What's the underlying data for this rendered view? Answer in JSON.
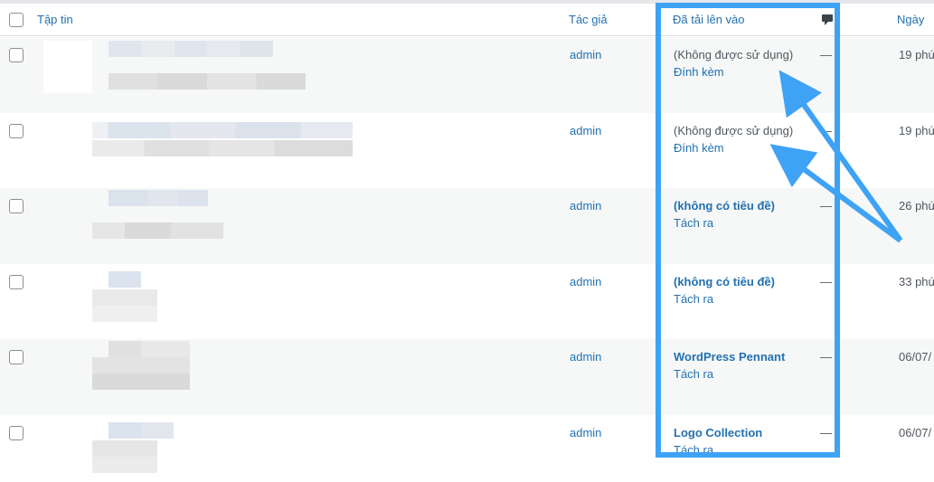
{
  "header": {
    "file_col": "Tập tin",
    "author_col": "Tác giả",
    "uploaded_to_col": "Đã tải lên vào",
    "comments_icon": "comment-bubble-icon",
    "date_col": "Ngày"
  },
  "rows": [
    {
      "author": "admin",
      "uploaded_to": "(Không được sử dụng)",
      "action": "Đính kèm",
      "comments": "—",
      "date": "19 phú"
    },
    {
      "author": "admin",
      "uploaded_to": "(Không được sử dụng)",
      "action": "Đính kèm",
      "comments": "—",
      "date": "19 phú"
    },
    {
      "author": "admin",
      "uploaded_to": "(không có tiêu đề)",
      "action": "Tách ra",
      "comments": "—",
      "date": "26 phú"
    },
    {
      "author": "admin",
      "uploaded_to": "(không có tiêu đề)",
      "action": "Tách ra",
      "comments": "—",
      "date": "33 phú"
    },
    {
      "author": "admin",
      "uploaded_to": "WordPress Pennant",
      "action": "Tách ra",
      "comments": "—",
      "date": "06/07/"
    },
    {
      "author": "admin",
      "uploaded_to": "Logo Collection",
      "action": "Tách ra",
      "comments": "—",
      "date": "06/07/"
    }
  ],
  "colors": {
    "link": "#2271b1",
    "highlight": "#3ea2f5",
    "alt_row": "#f6f7f7"
  }
}
